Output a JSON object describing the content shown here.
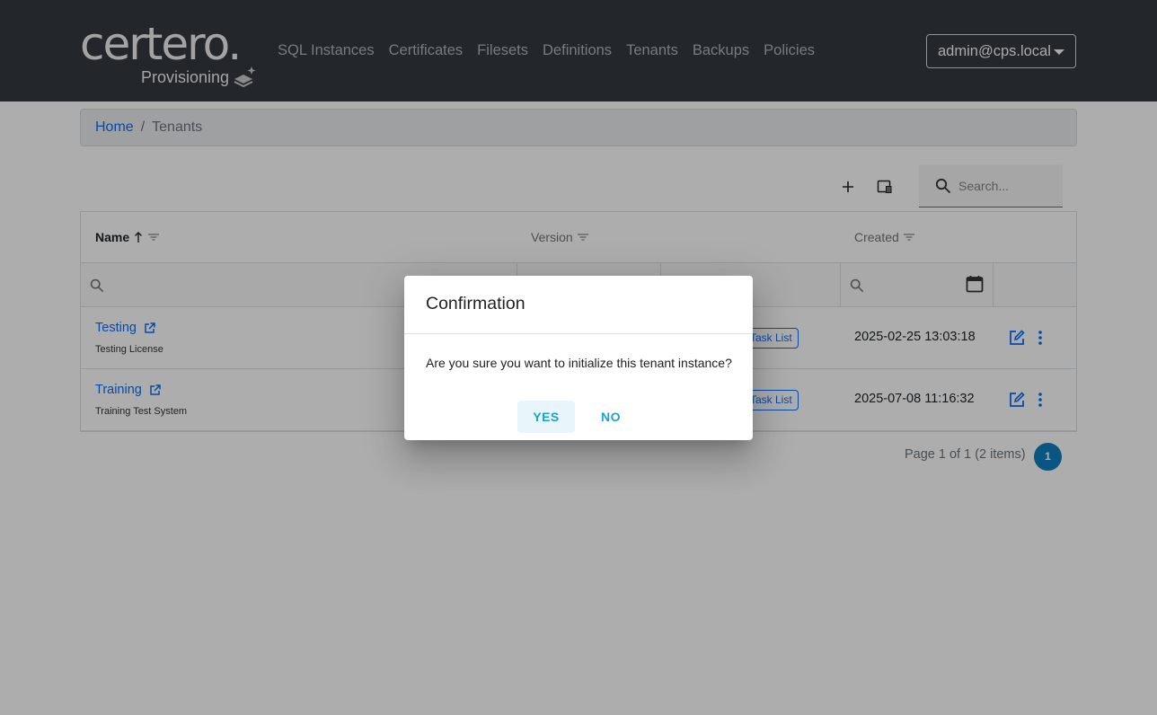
{
  "brand": {
    "name": "certero.",
    "subtitle": "Provisioning",
    "icon": "layers-sparkle-icon"
  },
  "nav": {
    "items": [
      "SQL Instances",
      "Certificates",
      "Filesets",
      "Definitions",
      "Tenants",
      "Backups",
      "Policies"
    ]
  },
  "user": {
    "label": "admin@cps.local",
    "icon": "caret-down-icon"
  },
  "breadcrumb": {
    "home": "Home",
    "separator": "/",
    "current": "Tenants"
  },
  "toolbar": {
    "add_icon": "plus-icon",
    "columns_icon": "column-chooser-icon",
    "search_placeholder": "Search...",
    "search_value": ""
  },
  "grid": {
    "columns": [
      {
        "label": "Name",
        "sort": "ascending"
      },
      {
        "label": "Version"
      },
      {
        "label": "Created"
      }
    ],
    "rows": [
      {
        "name": "Testing",
        "description": "Testing License",
        "tag": "Task List",
        "created": "2025-02-25 13:03:18"
      },
      {
        "name": "Training",
        "description": "Training Test System",
        "tag": "Task List",
        "created": "2025-07-08 11:16:32"
      }
    ]
  },
  "pager": {
    "info": "Page 1 of 1 (2 items)",
    "current_page": "1"
  },
  "dialog": {
    "title": "Confirmation",
    "message": "Are you sure you want to initialize this tenant instance?",
    "yes_label": "YES",
    "no_label": "NO"
  },
  "colors": {
    "navbar": "#343a40",
    "link": "#0d6efd",
    "accent": "#1ea0d6",
    "pager": "#0e7fc2"
  }
}
